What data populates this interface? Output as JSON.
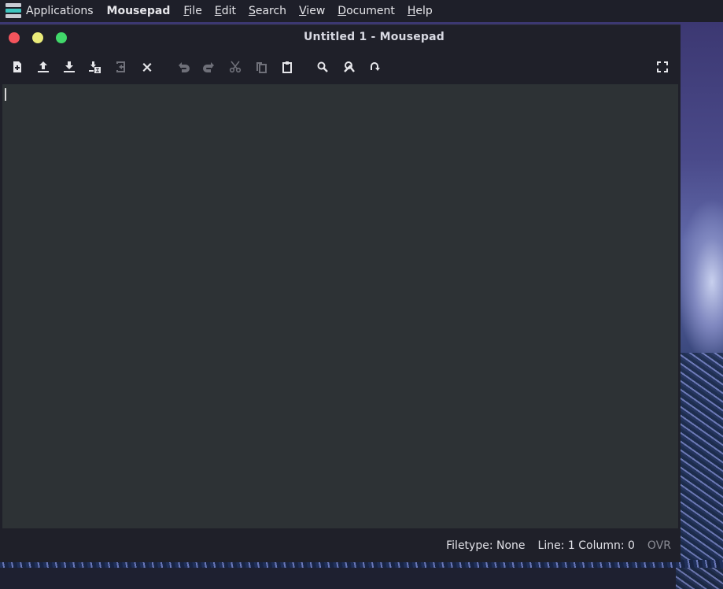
{
  "panel": {
    "applications_label": "Applications",
    "app_name": "Mousepad",
    "menus": [
      {
        "mnemonic": "F",
        "rest": "ile"
      },
      {
        "mnemonic": "E",
        "rest": "dit"
      },
      {
        "mnemonic": "S",
        "rest": "earch"
      },
      {
        "mnemonic": "V",
        "rest": "iew"
      },
      {
        "mnemonic": "D",
        "rest": "ocument"
      },
      {
        "mnemonic": "H",
        "rest": "elp"
      }
    ]
  },
  "window": {
    "title": "Untitled 1 - Mousepad"
  },
  "toolbar": {
    "icons": [
      "new-document-icon",
      "open-icon",
      "save-icon",
      "save-as-icon",
      "revert-icon",
      "close-tab-icon",
      "undo-icon",
      "redo-icon",
      "cut-icon",
      "copy-icon",
      "paste-icon",
      "find-icon",
      "find-replace-icon",
      "goto-line-icon",
      "fullscreen-icon"
    ]
  },
  "editor": {
    "content": ""
  },
  "statusbar": {
    "filetype": "Filetype: None",
    "position": "Line: 1 Column: 0",
    "mode": "OVR"
  },
  "colors": {
    "panel_bg": "#1e1f29",
    "window_bg": "#1f2029",
    "editor_bg": "#2d3235",
    "close": "#f4545c",
    "minimize": "#eaeb7a",
    "maximize": "#41d86a",
    "accent": "#3ec6c0"
  }
}
